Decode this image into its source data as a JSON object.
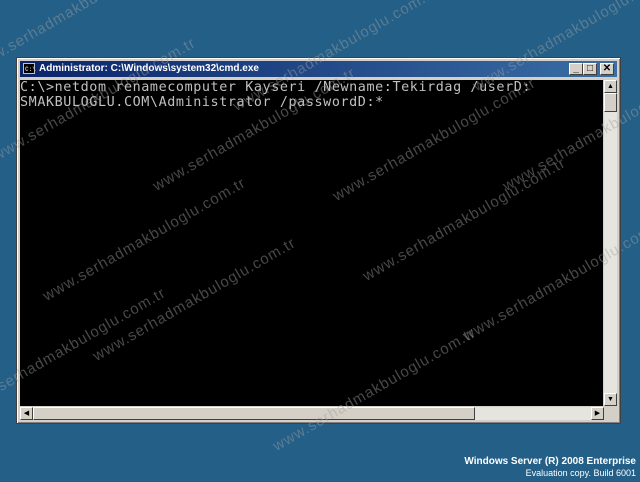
{
  "window": {
    "title": "Administrator: C:\\Windows\\system32\\cmd.exe",
    "icon": "cmd-icon",
    "icon_text": "C:\\",
    "controls": {
      "minimize": "_",
      "maximize": "□",
      "close": "✕"
    }
  },
  "console": {
    "line1": "C:\\>netdom renamecomputer Kayseri /Newname:Tekirdag /userD:",
    "line2": "SMAKBULOGLU.COM\\Administrator /passwordD:*"
  },
  "scrollbars": {
    "up": "▲",
    "down": "▼",
    "left": "◀",
    "right": "▶"
  },
  "watermark": "www.serhadmakbuloglu.com.tr",
  "branding": {
    "title": "Windows Server (R) 2008 Enterprise",
    "subtitle": "Evaluation copy. Build 6001"
  },
  "colors": {
    "desktop": "#235f87",
    "console_bg": "#000000",
    "console_text": "#c0c0c0",
    "titlebar": "#0a246a"
  }
}
